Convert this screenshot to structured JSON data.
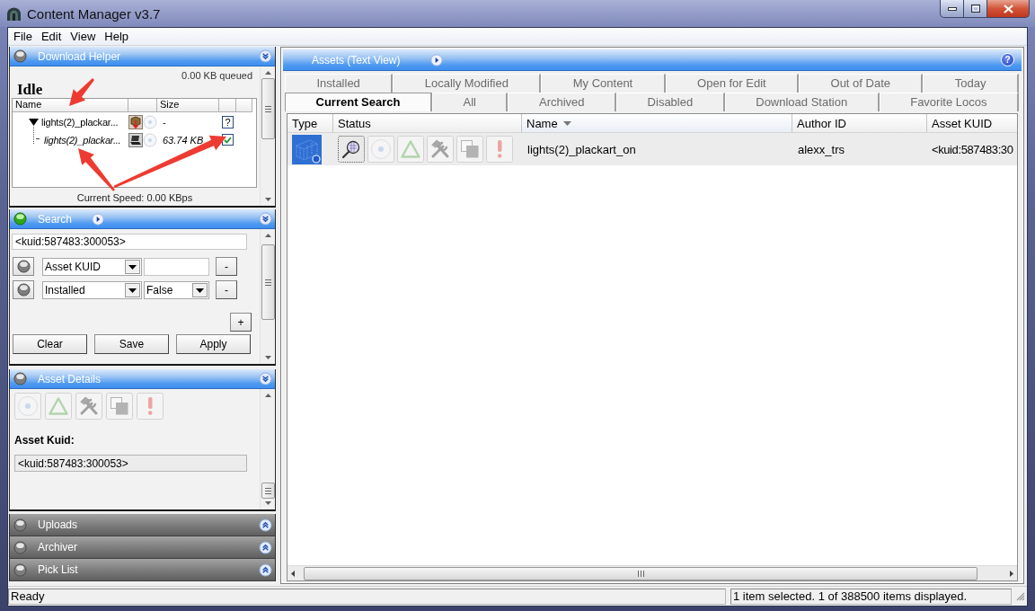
{
  "window": {
    "title": "Content Manager v3.7"
  },
  "menu": [
    {
      "label": "File"
    },
    {
      "label": "Edit"
    },
    {
      "label": "View"
    },
    {
      "label": "Help"
    }
  ],
  "download_helper": {
    "title": "Download Helper",
    "expanded": true,
    "active": false,
    "state": "Idle",
    "queued": "0.00 KB queued",
    "columns": {
      "name": "Name",
      "size": "Size"
    },
    "rows": [
      {
        "name": "lights(2)_plackar...",
        "size": "-",
        "kind": "unknown",
        "mark": "?",
        "expanded": true,
        "children": [
          {
            "name": "lights(2)_plackar...",
            "size": "63.74 KB",
            "kind": "checkbox",
            "checked": true
          }
        ]
      }
    ],
    "speed": "Current Speed: 0.00 KBps"
  },
  "search": {
    "title": "Search",
    "expanded": true,
    "active": true,
    "query": "<kuid:587483:300053>",
    "filters": [
      {
        "field": "Asset KUID",
        "kind": "text",
        "remove": "-"
      },
      {
        "field": "Installed",
        "kind": "select",
        "value": "False",
        "remove": "-"
      }
    ],
    "add": "+",
    "buttons": [
      {
        "label": "Clear"
      },
      {
        "label": "Save"
      },
      {
        "label": "Apply"
      }
    ]
  },
  "asset_details": {
    "title": "Asset Details",
    "expanded": true,
    "active": false,
    "actions": [
      {
        "disabled": true
      },
      {
        "disabled": true
      },
      {
        "disabled": true
      },
      {
        "disabled": true
      },
      {
        "disabled": true
      }
    ],
    "kuid_label": "Asset Kuid:",
    "kuid": "<kuid:587483:300053>"
  },
  "collapsed_panels": [
    {
      "title": "Uploads",
      "expanded": false,
      "active": false
    },
    {
      "title": "Archiver",
      "expanded": false,
      "active": false
    },
    {
      "title": "Pick List",
      "expanded": false,
      "active": false
    }
  ],
  "assets": {
    "title": "Assets (Text View)",
    "help": "?",
    "tab_rows": [
      {
        "tabs": [
          {
            "label": "Installed",
            "selected": false
          },
          {
            "label": "Locally Modified",
            "selected": false
          },
          {
            "label": "My Content",
            "selected": false
          },
          {
            "label": "Open for Edit",
            "selected": false
          },
          {
            "label": "Out of Date",
            "selected": false
          },
          {
            "label": "Today",
            "selected": false
          }
        ]
      },
      {
        "tabs": [
          {
            "label": "Current Search",
            "selected": true
          },
          {
            "label": "All",
            "selected": false
          },
          {
            "label": "Archived",
            "selected": false
          },
          {
            "label": "Disabled",
            "selected": false
          },
          {
            "label": "Download Station",
            "selected": false
          },
          {
            "label": "Favorite Locos",
            "selected": false
          }
        ]
      }
    ],
    "table": {
      "columns": [
        {
          "label": "Type",
          "sorted": false
        },
        {
          "label": "Status",
          "sorted": false
        },
        {
          "label": "Name",
          "sorted": true
        },
        {
          "label": "Author ID",
          "sorted": false
        },
        {
          "label": "Asset KUID",
          "sorted": false
        }
      ],
      "rows": [
        {
          "selected": true,
          "status": [
            {
              "disabled": false
            },
            {
              "disabled": true
            },
            {
              "disabled": true
            },
            {
              "disabled": true
            },
            {
              "disabled": true
            },
            {
              "disabled": true
            }
          ],
          "name": "lights(2)_plackart_on",
          "author": "alexx_trs",
          "kuid": "<kuid:587483:30"
        }
      ]
    }
  },
  "status_bar": {
    "left": "Ready",
    "right": "1 item selected. 1 of 388500 items displayed."
  }
}
